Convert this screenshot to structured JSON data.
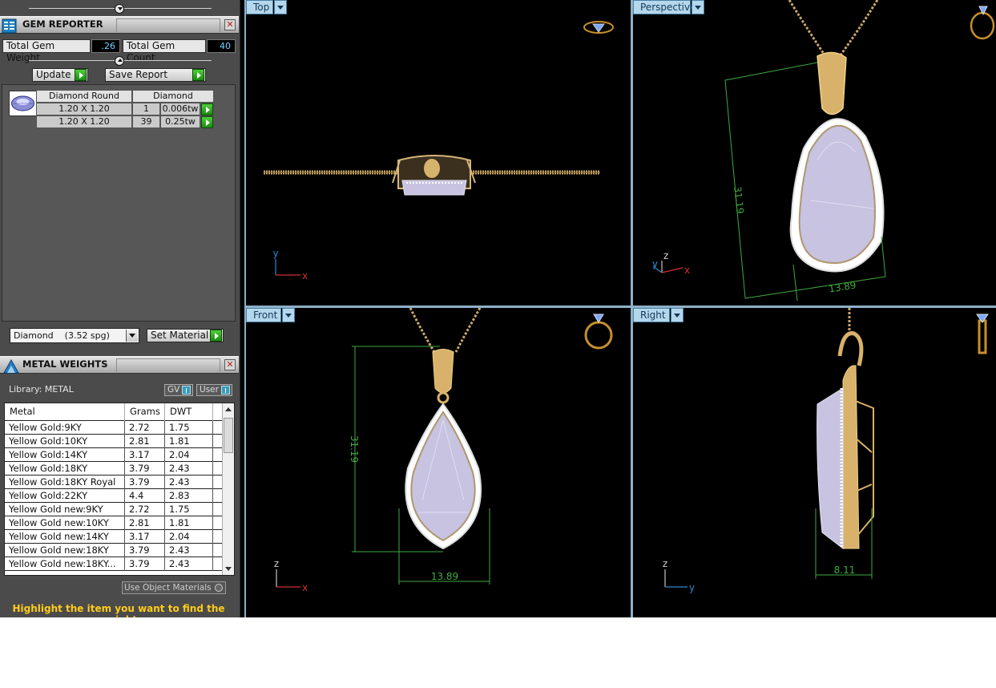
{
  "gem_reporter": {
    "title": "GEM REPORTER",
    "close": "✕",
    "total_weight_label": "Total Gem Weight",
    "total_weight_value": ".26",
    "total_count_label": "Total Gem Count",
    "total_count_value": "40",
    "update_label": "Update",
    "save_report_label": "Save Report",
    "header_shape": "Diamond Round",
    "header_material": "Diamond",
    "rows": [
      {
        "size": "1.20 X 1.20",
        "qty": "1",
        "weight": "0.006tw"
      },
      {
        "size": "1.20 X 1.20",
        "qty": "39",
        "weight": "0.25tw"
      }
    ],
    "material_select": "Diamond    (3.52 spg)",
    "set_material_label": "Set Material"
  },
  "metal_weights": {
    "title": "METAL WEIGHTS",
    "close": "✕",
    "library_label": "Library: METAL",
    "gv_label": "GV",
    "user_label": "User",
    "columns": [
      "Metal",
      "Grams",
      "DWT"
    ],
    "rows": [
      {
        "metal": "Yellow Gold:9KY",
        "grams": "2.72",
        "dwt": "1.75"
      },
      {
        "metal": "Yellow Gold:10KY",
        "grams": "2.81",
        "dwt": "1.81"
      },
      {
        "metal": "Yellow Gold:14KY",
        "grams": "3.17",
        "dwt": "2.04"
      },
      {
        "metal": "Yellow Gold:18KY",
        "grams": "3.79",
        "dwt": "2.43"
      },
      {
        "metal": "Yellow Gold:18KY Royal",
        "grams": "3.79",
        "dwt": "2.43"
      },
      {
        "metal": "Yellow Gold:22KY",
        "grams": "4.4",
        "dwt": "2.83"
      },
      {
        "metal": "Yellow Gold new:9KY",
        "grams": "2.72",
        "dwt": "1.75"
      },
      {
        "metal": "Yellow Gold new:10KY",
        "grams": "2.81",
        "dwt": "1.81"
      },
      {
        "metal": "Yellow Gold new:14KY",
        "grams": "3.17",
        "dwt": "2.04"
      },
      {
        "metal": "Yellow Gold new:18KY",
        "grams": "3.79",
        "dwt": "2.43"
      },
      {
        "metal": "Yellow Gold new:18KY...",
        "grams": "3.79",
        "dwt": "2.43"
      }
    ],
    "use_object_materials": "Use Object Materials",
    "hint": "Highlight the item you want to find the weight"
  },
  "viewports": {
    "top": {
      "label": "Top",
      "axis_a": "y",
      "axis_b": "x"
    },
    "perspective": {
      "label": "Perspective",
      "axis_a": "z",
      "axis_b": "x",
      "axis_c": "y",
      "dim_height": "31.19",
      "dim_width": "13.89"
    },
    "front": {
      "label": "Front",
      "axis_a": "z",
      "axis_b": "x",
      "dim_height": "31.19",
      "dim_width": "13.89"
    },
    "right": {
      "label": "Right",
      "axis_a": "z",
      "axis_b": "y",
      "dim_width": "8.11"
    }
  },
  "colors": {
    "panel_bg": "#4b4b4b",
    "viewport_bg": "#000000",
    "viewport_tab": "#b5d7ec",
    "gold": "#c9a766",
    "gem": "#c7c3e0",
    "dimension": "#3faa3f",
    "hint_text": "#ffcc1a",
    "value_text": "#67d6ff"
  }
}
